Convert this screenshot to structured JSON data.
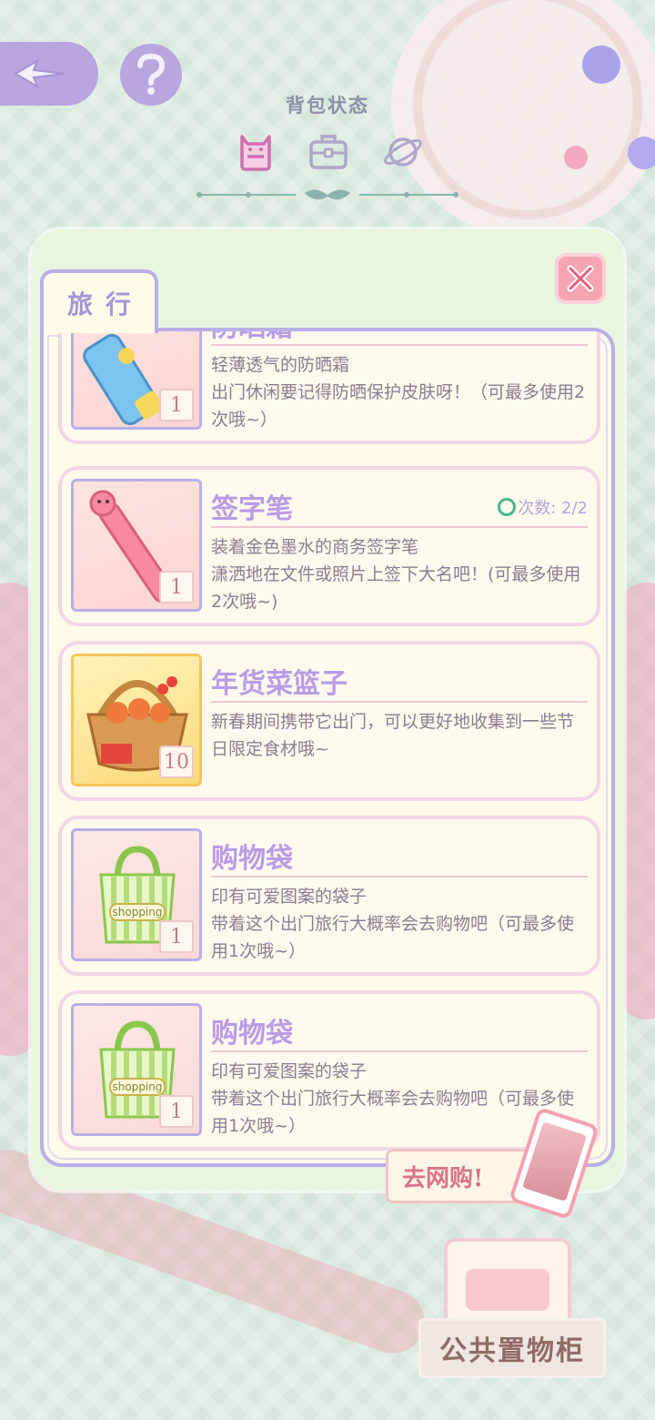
{
  "header": {
    "title": "背包状态",
    "tabs": [
      {
        "icon": "cat-backpack-icon",
        "active": true
      },
      {
        "icon": "suitcase-icon",
        "active": false
      },
      {
        "icon": "planet-icon",
        "active": false
      }
    ]
  },
  "panel": {
    "tab_label": "旅行",
    "items": [
      {
        "name": "防晒霜",
        "uses": "",
        "desc_line1": "轻薄透气的防晒霜",
        "desc_line2": "出门休闲要记得防晒保护皮肤呀！（可最多使用2次哦~）",
        "count": "1",
        "icon": "sunscreen-icon"
      },
      {
        "name": "签字笔",
        "uses": "次数: 2/2",
        "desc_line1": "装着金色墨水的商务签字笔",
        "desc_line2": "潇洒地在文件或照片上签下大名吧！(可最多使用2次哦~)",
        "count": "1",
        "icon": "pen-icon"
      },
      {
        "name": "年货菜篮子",
        "uses": "",
        "desc_line1": "新春期间携带它出门，可以更好地收集到一些节日限定食材哦~",
        "desc_line2": "",
        "count": "10",
        "icon": "basket-icon"
      },
      {
        "name": "购物袋",
        "uses": "",
        "desc_line1": "印有可爱图案的袋子",
        "desc_line2": "带着这个出门旅行大概率会去购物吧（可最多使用1次哦~）",
        "count": "1",
        "icon": "shopping-bag-icon"
      },
      {
        "name": "购物袋",
        "uses": "",
        "desc_line1": "印有可爱图案的袋子",
        "desc_line2": "带着这个出门旅行大概率会去购物吧（可最多使用1次哦~）",
        "count": "1",
        "icon": "shopping-bag-icon"
      }
    ],
    "bag_print": "shopping"
  },
  "shop_button": {
    "label": "去网购!"
  },
  "locker": {
    "label": "公共置物柜"
  },
  "colors": {
    "accent": "#b9aee6",
    "name": "#b99be6",
    "close": "#f7a5b1"
  }
}
